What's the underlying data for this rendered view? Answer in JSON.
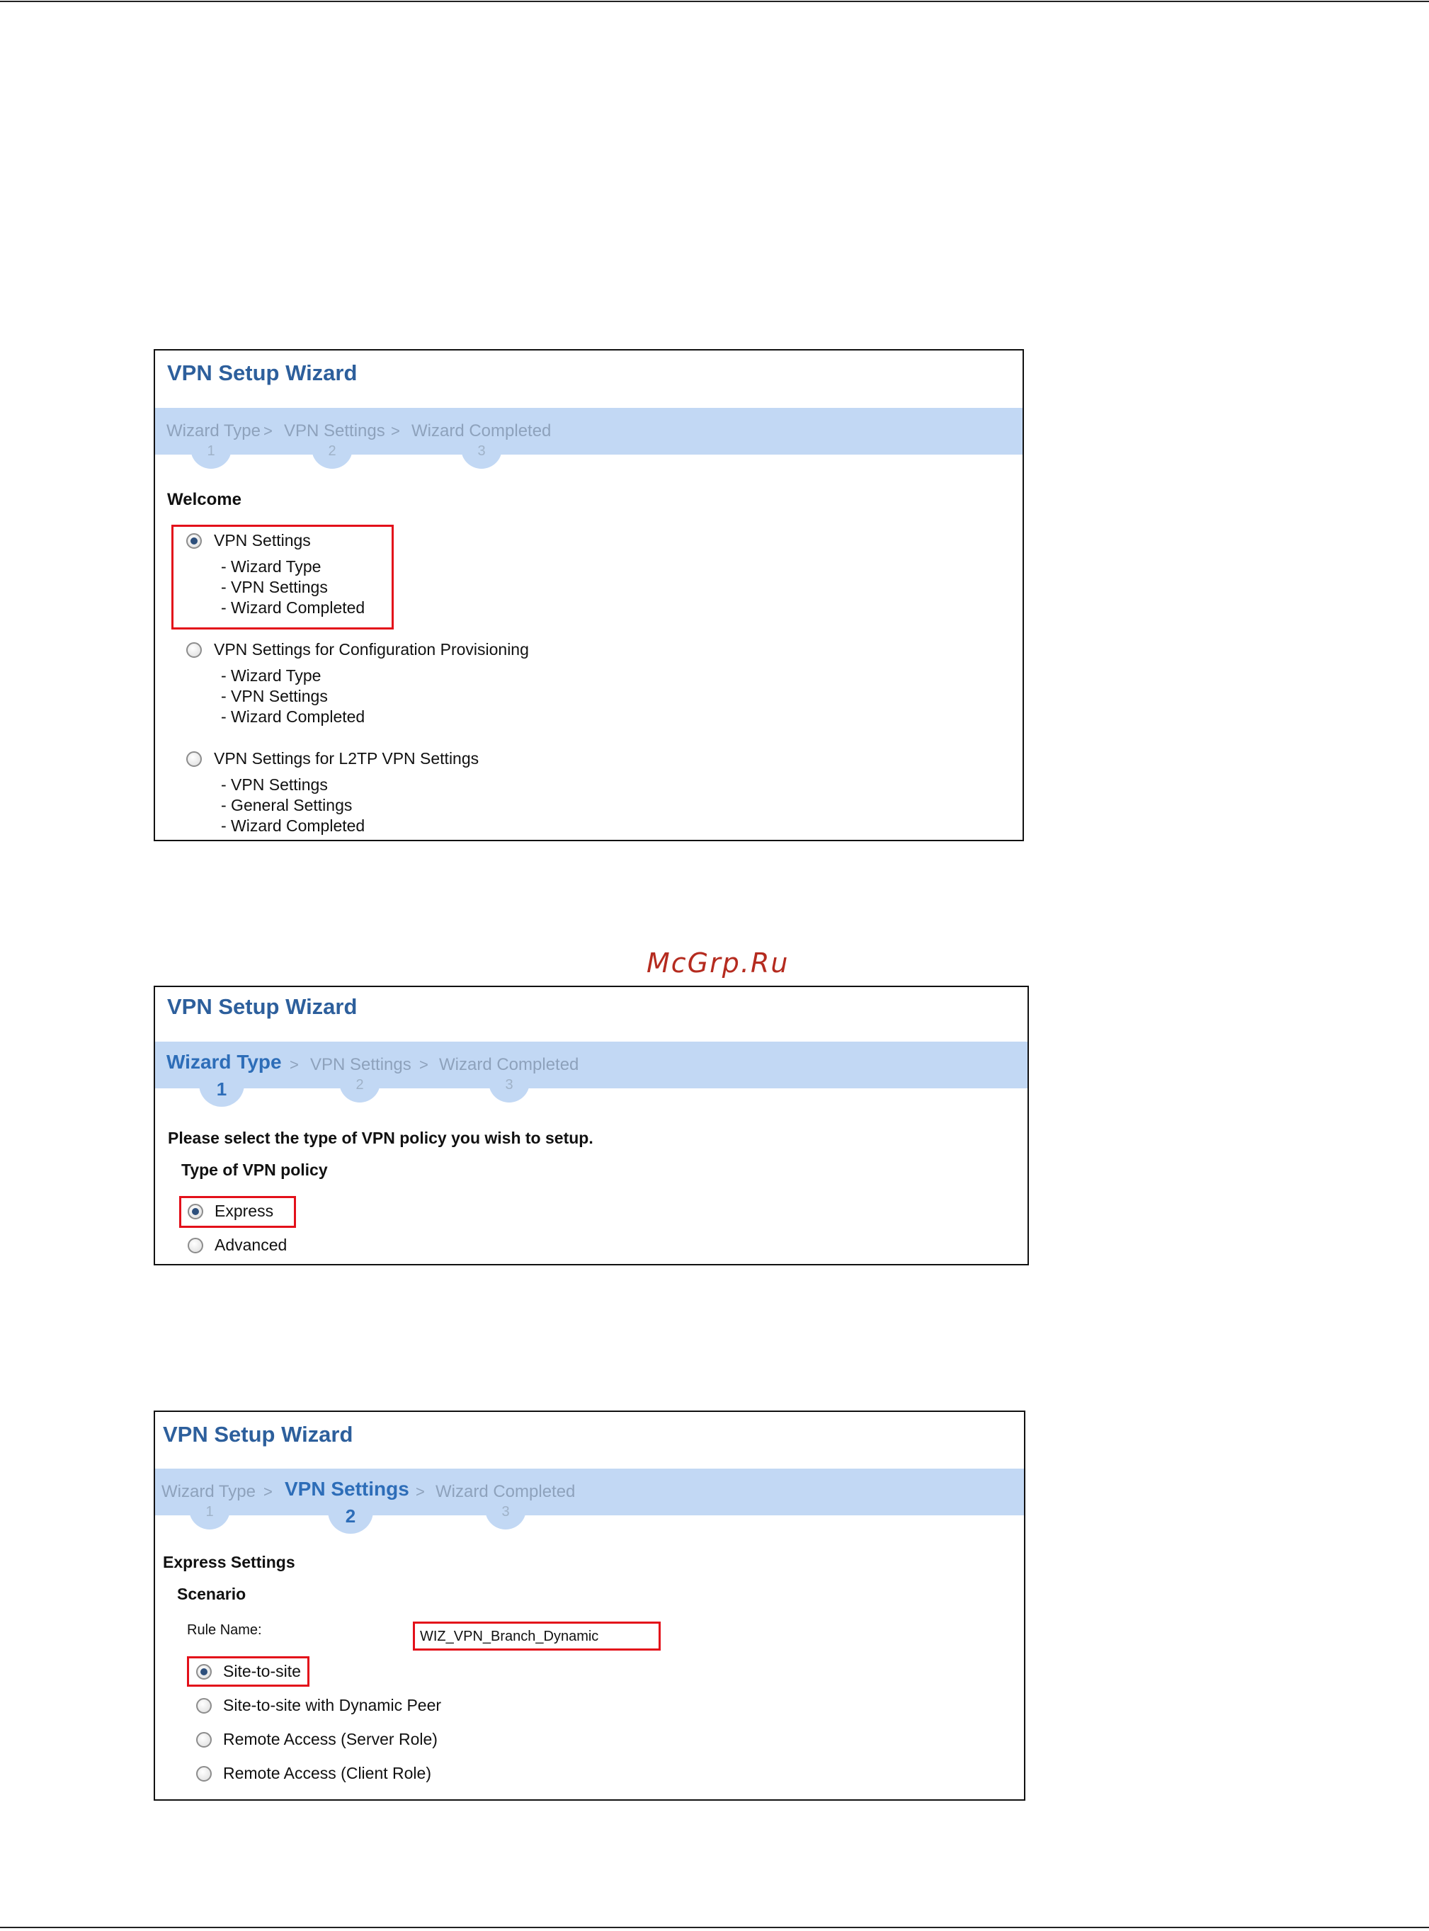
{
  "watermark": "McGrp.Ru",
  "panels": [
    {
      "title": "VPN Setup Wizard",
      "steps": [
        {
          "label": "Wizard Type",
          "num": "1"
        },
        {
          "label": "VPN Settings",
          "num": "2"
        },
        {
          "label": "Wizard Completed",
          "num": "3"
        }
      ],
      "heading": "Welcome",
      "options": [
        {
          "label": "VPN Settings",
          "selected": true,
          "items": [
            "- Wizard Type",
            "- VPN Settings",
            "- Wizard Completed"
          ]
        },
        {
          "label": "VPN Settings for Configuration Provisioning",
          "selected": false,
          "items": [
            "- Wizard Type",
            "- VPN Settings",
            "- Wizard Completed"
          ]
        },
        {
          "label": "VPN Settings for L2TP VPN Settings",
          "selected": false,
          "items": [
            "- VPN Settings",
            "- General Settings",
            "- Wizard Completed"
          ]
        }
      ]
    },
    {
      "title": "VPN Setup Wizard",
      "steps": [
        {
          "label": "Wizard Type",
          "num": "1"
        },
        {
          "label": "VPN Settings",
          "num": "2"
        },
        {
          "label": "Wizard Completed",
          "num": "3"
        }
      ],
      "active_step": 1,
      "prompt": "Please select the type of VPN policy you wish to setup.",
      "section": "Type of VPN policy",
      "options": [
        {
          "label": "Express",
          "selected": true
        },
        {
          "label": "Advanced",
          "selected": false
        }
      ]
    },
    {
      "title": "VPN Setup Wizard",
      "steps": [
        {
          "label": "Wizard Type",
          "num": "1"
        },
        {
          "label": "VPN Settings",
          "num": "2"
        },
        {
          "label": "Wizard Completed",
          "num": "3"
        }
      ],
      "active_step": 2,
      "heading": "Express Settings",
      "section": "Scenario",
      "rule_name_label": "Rule Name:",
      "rule_name_value": "WIZ_VPN_Branch_Dynamic",
      "options": [
        {
          "label": "Site-to-site",
          "selected": true
        },
        {
          "label": "Site-to-site with Dynamic Peer",
          "selected": false
        },
        {
          "label": "Remote Access (Server Role)",
          "selected": false
        },
        {
          "label": "Remote Access (Client Role)",
          "selected": false
        }
      ]
    }
  ],
  "colors": {
    "title_blue": "#2d5f9c",
    "band": "#c2d8f4",
    "active_step": "#2d6db8",
    "inactive_step": "#8ea2bc",
    "highlight_red": "#e3101a",
    "watermark": "#b52b1f"
  }
}
